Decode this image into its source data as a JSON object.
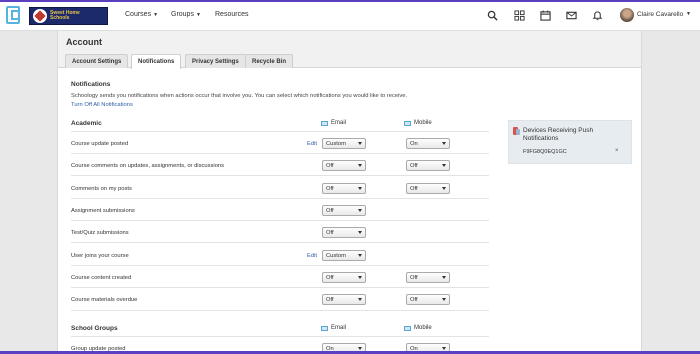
{
  "brand": {
    "school_name_line1": "Sweet Home",
    "school_name_line2": "Schools"
  },
  "nav": {
    "courses": "Courses",
    "groups": "Groups",
    "resources": "Resources",
    "user_name": "Claire Cavarello",
    "icons": [
      "search-icon",
      "apps-icon",
      "calendar-icon",
      "messages-icon",
      "notifications-icon"
    ]
  },
  "page": {
    "title": "Account",
    "tabs": [
      "Account Settings",
      "Notifications",
      "Privacy Settings",
      "Recycle Bin"
    ],
    "active_tab": "Notifications"
  },
  "notifications": {
    "heading": "Notifications",
    "description": "Schoology sends you notifications when actions occur that involve you. You can select which notifications you would like to receive.",
    "turn_off_all": "Turn Off All Notifications",
    "edit_label": "Edit",
    "academic": {
      "title": "Academic",
      "email_header": "Email",
      "mobile_header": "Mobile",
      "rows": [
        {
          "label": "Course update posted",
          "edit": true,
          "email": "Custom",
          "mobile": "On"
        },
        {
          "label": "Course comments on updates, assignments, or discussions",
          "edit": false,
          "email": "Off",
          "mobile": "Off"
        },
        {
          "label": "Comments on my posts",
          "edit": false,
          "email": "Off",
          "mobile": "Off"
        },
        {
          "label": "Assignment submissions",
          "edit": false,
          "email": "Off",
          "mobile": null
        },
        {
          "label": "Test/Quiz submissions",
          "edit": false,
          "email": "Off",
          "mobile": null
        },
        {
          "label": "User joins your course",
          "edit": true,
          "email": "Custom",
          "mobile": null
        },
        {
          "label": "Course content created",
          "edit": false,
          "email": "Off",
          "mobile": "Off"
        },
        {
          "label": "Course materials overdue",
          "edit": false,
          "email": "Off",
          "mobile": "Off"
        }
      ]
    },
    "school_groups": {
      "title": "School Groups",
      "email_header": "Email",
      "mobile_header": "Mobile",
      "rows": [
        {
          "label": "Group update posted",
          "edit": false,
          "email": "On",
          "mobile": "On"
        }
      ]
    }
  },
  "push": {
    "title": "Devices Receiving Push Notifications",
    "device": "F9FG8Q0EQ1GC",
    "remove": "×"
  }
}
